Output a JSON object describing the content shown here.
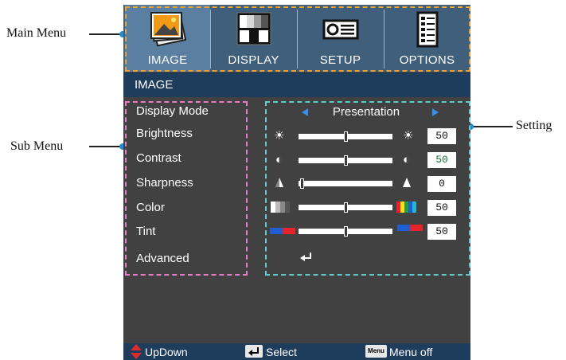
{
  "callouts": {
    "main_menu": "Main Menu",
    "sub_menu": "Sub Menu",
    "setting": "Setting"
  },
  "menu": {
    "tabs": [
      {
        "label": "IMAGE",
        "icon": "image-icon",
        "active": true
      },
      {
        "label": "DISPLAY",
        "icon": "display-icon",
        "active": false
      },
      {
        "label": "SETUP",
        "icon": "projector-icon",
        "active": false
      },
      {
        "label": "OPTIONS",
        "icon": "options-icon",
        "active": false
      }
    ]
  },
  "section_title": "IMAGE",
  "submenu": {
    "items": [
      "Display Mode",
      "Brightness",
      "Contrast",
      "Sharpness",
      "Color",
      "Tint",
      "Advanced"
    ]
  },
  "settings": {
    "display_mode": "Presentation",
    "brightness": {
      "value": "50",
      "level": 0.5
    },
    "contrast": {
      "value": "50",
      "level": 0.5
    },
    "sharpness": {
      "value": "0",
      "level": 0.0
    },
    "color": {
      "value": "50",
      "level": 0.5
    },
    "tint": {
      "value": "50",
      "level": 0.5
    }
  },
  "footer": {
    "updown": "UpDown",
    "select": "Select",
    "menu_key": "Menu",
    "menu_off": "Menu off"
  },
  "colors": {
    "accent": "#5a7fa0",
    "menubar": "#3f5f7a",
    "section_bar": "#1e3c5c",
    "panel": "#414141",
    "menu_outline": "#e8a33a",
    "submenu_outline": "#e57cc6",
    "settings_outline": "#63c9c9",
    "callout_dot": "#1e8fd6"
  }
}
